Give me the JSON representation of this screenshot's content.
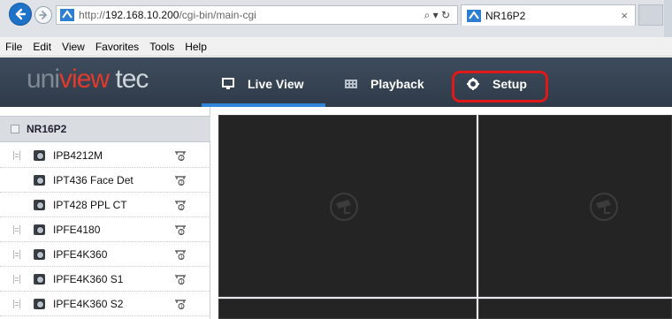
{
  "browser": {
    "url_prefix": "http://",
    "url_host": "192.168.10.200",
    "url_path": "/cgi-bin/main-cgi",
    "search_glyph": "⌕ ▾ ↻",
    "tab_title": "NR16P2",
    "tab_close": "×"
  },
  "menubar": {
    "items": [
      "File",
      "Edit",
      "View",
      "Favorites",
      "Tools",
      "Help"
    ]
  },
  "header": {
    "logo_part1": "uni",
    "logo_part2": "view",
    "logo_part3": " tec",
    "nav": {
      "live_view": "Live View",
      "playback": "Playback",
      "setup": "Setup"
    },
    "active_tab": "Live View",
    "highlight_color": "#e01818",
    "accent_color": "#2f86d9"
  },
  "device_tree": {
    "title": "NR16P2",
    "cameras": [
      {
        "label": "IPB4212M",
        "indent": false,
        "stream": "stream-2-icon"
      },
      {
        "label": "IPT436 Face Det",
        "indent": true,
        "stream": "stream-2-icon"
      },
      {
        "label": "IPT428 PPL CT",
        "indent": true,
        "stream": "stream-2-icon"
      },
      {
        "label": "IPFE4180",
        "indent": false,
        "stream": "stream-2-icon"
      },
      {
        "label": "IPFE4K360",
        "indent": false,
        "stream": "stream-1-icon"
      },
      {
        "label": "IPFE4K360 S1",
        "indent": false,
        "stream": "stream-1-icon"
      },
      {
        "label": "IPFE4K360 S2",
        "indent": false,
        "stream": "stream-1-icon"
      }
    ]
  }
}
